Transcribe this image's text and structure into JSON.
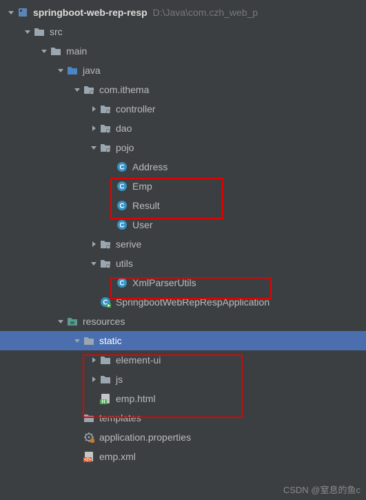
{
  "project": {
    "name": "springboot-web-rep-resp",
    "path": "D:\\Java\\com.czh_web_p"
  },
  "tree": {
    "src": "src",
    "main": "main",
    "java": "java",
    "pkg": "com.ithema",
    "controller": "controller",
    "dao": "dao",
    "pojo": "pojo",
    "address": "Address",
    "emp": "Emp",
    "result": "Result",
    "user": "User",
    "serive": "serive",
    "utils": "utils",
    "xmlparser": "XmlParserUtils",
    "app": "SpringbootWebRepRespApplication",
    "resources": "resources",
    "static": "static",
    "elementui": "element-ui",
    "js": "js",
    "emphtml": "emp.html",
    "templates": "templates",
    "appprops": "application.properties",
    "empxml": "emp.xml"
  },
  "watermark": "CSDN @窒息的鱼c"
}
